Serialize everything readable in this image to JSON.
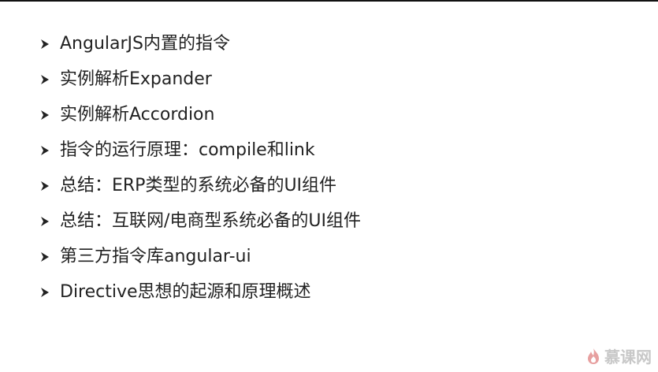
{
  "slide": {
    "items": [
      {
        "text": "AngularJS内置的指令"
      },
      {
        "text": "实例解析Expander"
      },
      {
        "text": "实例解析Accordion"
      },
      {
        "text": "指令的运行原理：compile和link"
      },
      {
        "text": "总结：ERP类型的系统必备的UI组件"
      },
      {
        "text": "总结：互联网/电商型系统必备的UI组件"
      },
      {
        "text": "第三方指令库angular-ui"
      },
      {
        "text": "Directive思想的起源和原理概述"
      }
    ],
    "bullet_icon": "chevron-right-arrow-icon"
  },
  "watermark": {
    "text": "慕课网",
    "icon": "flame-logo-icon",
    "color": "#c8c8c8"
  }
}
